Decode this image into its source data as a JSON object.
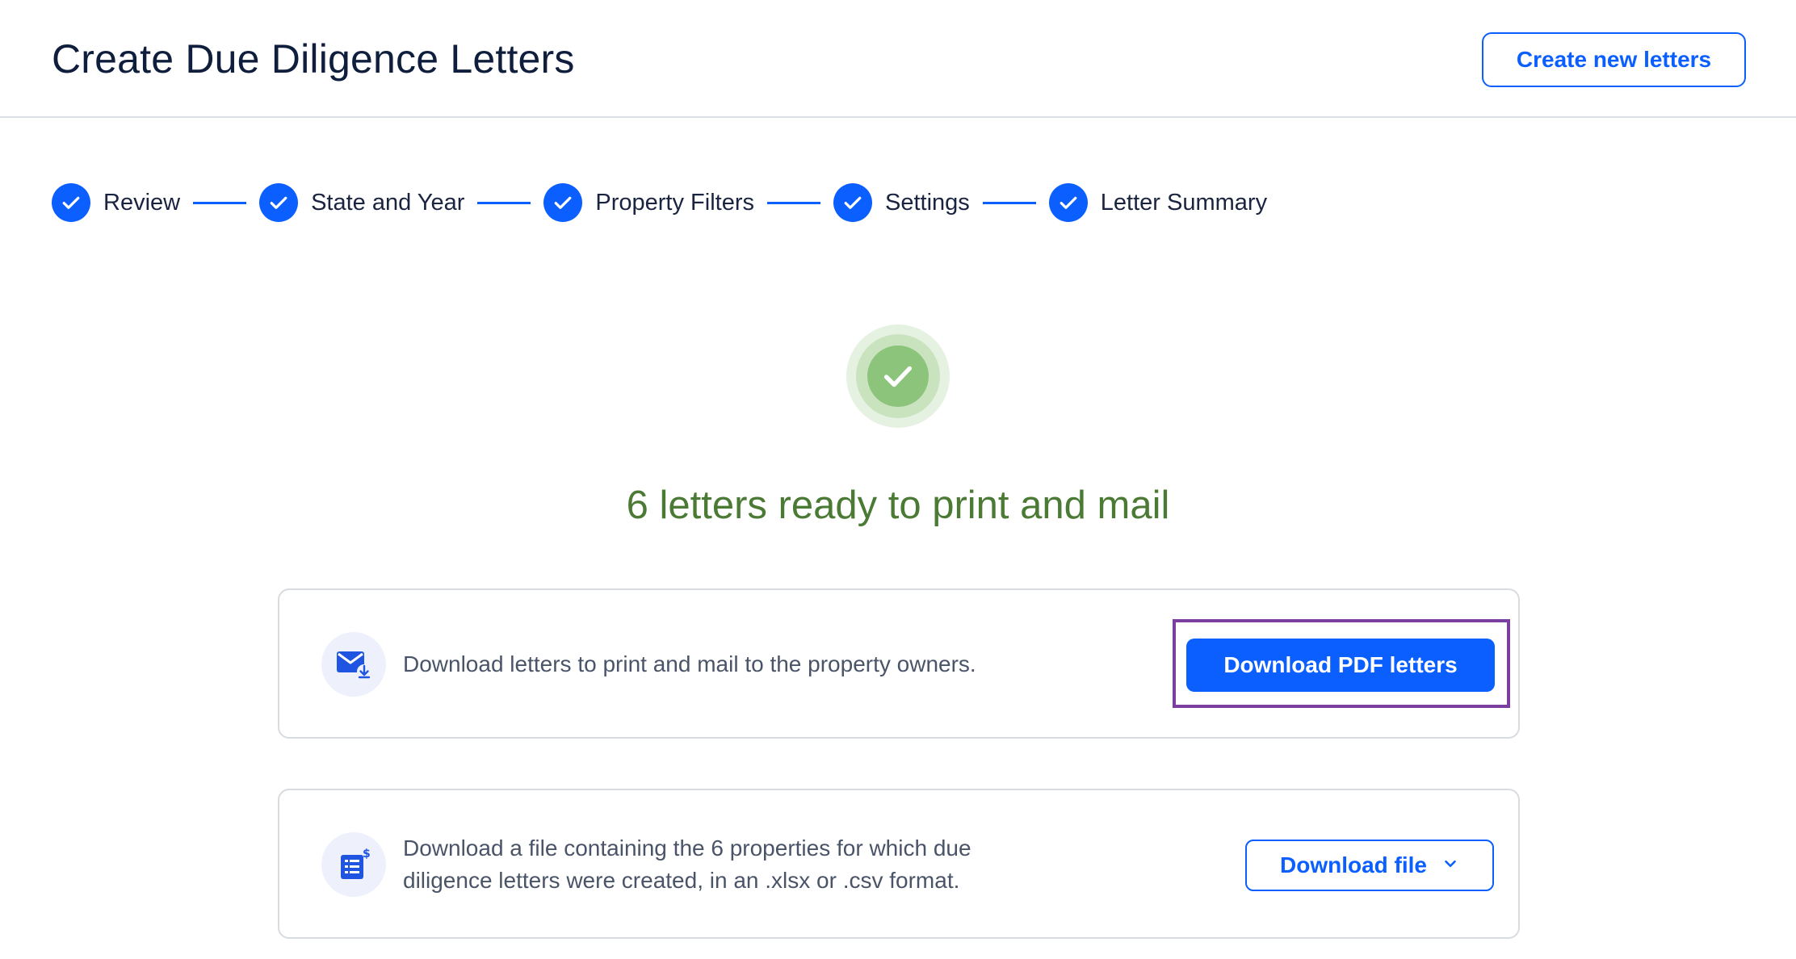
{
  "header": {
    "title": "Create Due Diligence Letters",
    "create_new_label": "Create new letters"
  },
  "stepper": {
    "steps": [
      {
        "label": "Review",
        "status": "complete"
      },
      {
        "label": "State and Year",
        "status": "complete"
      },
      {
        "label": "Property Filters",
        "status": "complete"
      },
      {
        "label": "Settings",
        "status": "complete"
      },
      {
        "label": "Letter Summary",
        "status": "complete"
      }
    ]
  },
  "summary": {
    "title": "6 letters ready to print and mail"
  },
  "cards": {
    "pdf": {
      "icon": "mail-download-icon",
      "text": "Download letters to print and mail to the property owners.",
      "button_label": "Download PDF letters"
    },
    "file": {
      "icon": "spreadsheet-dollar-icon",
      "text": "Download a file containing the 6 properties for which due diligence letters were created, in an .xlsx or .csv format.",
      "button_label": "Download file"
    }
  },
  "colors": {
    "primary": "#0b5fff",
    "success": "#4a7a34",
    "highlight": "#7b3fa0"
  }
}
